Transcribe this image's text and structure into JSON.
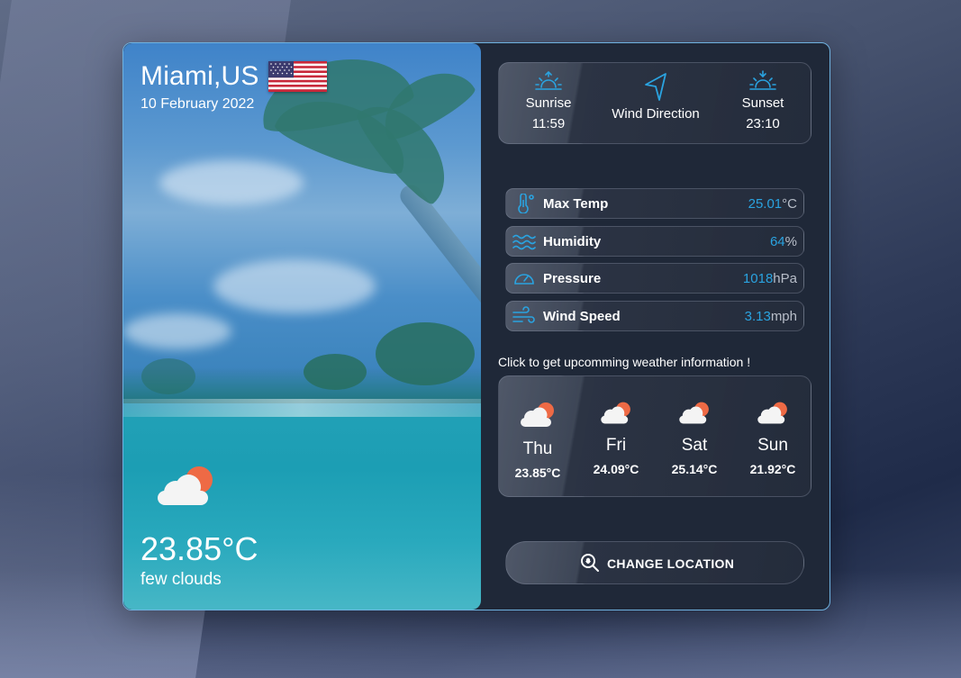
{
  "location": {
    "city": "Miami,US",
    "date": "10 February 2022",
    "flag_icon": "us-flag-icon"
  },
  "current": {
    "temperature": "23.85°C",
    "description": "few clouds",
    "icon": "few-clouds-icon"
  },
  "sun_panel": {
    "sunrise_label": "Sunrise",
    "sunrise_time": "11:59",
    "wind_direction_label": "Wind Direction",
    "sunset_label": "Sunset",
    "sunset_time": "23:10"
  },
  "stats": [
    {
      "label": "Max Temp",
      "value": "25.01",
      "unit": "°C",
      "icon": "thermometer-icon"
    },
    {
      "label": "Humidity",
      "value": "64",
      "unit": "%",
      "icon": "waves-icon"
    },
    {
      "label": "Pressure",
      "value": "1018",
      "unit": "hPa",
      "icon": "gauge-icon"
    },
    {
      "label": "Wind Speed",
      "value": "3.13",
      "unit": "mph",
      "icon": "wind-icon"
    }
  ],
  "forecast_hint": "Click to get upcomming weather information !",
  "forecast": [
    {
      "day": "Thu",
      "temp": "23.85°C"
    },
    {
      "day": "Fri",
      "temp": "24.09°C"
    },
    {
      "day": "Sat",
      "temp": "25.14°C"
    },
    {
      "day": "Sun",
      "temp": "21.92°C"
    }
  ],
  "change_location_label": "CHANGE LOCATION",
  "colors": {
    "accent": "#2aa3e0",
    "card_border": "#6fb2e0",
    "panel_bg": "#1f2838",
    "sun_orange": "#ee6a45"
  }
}
